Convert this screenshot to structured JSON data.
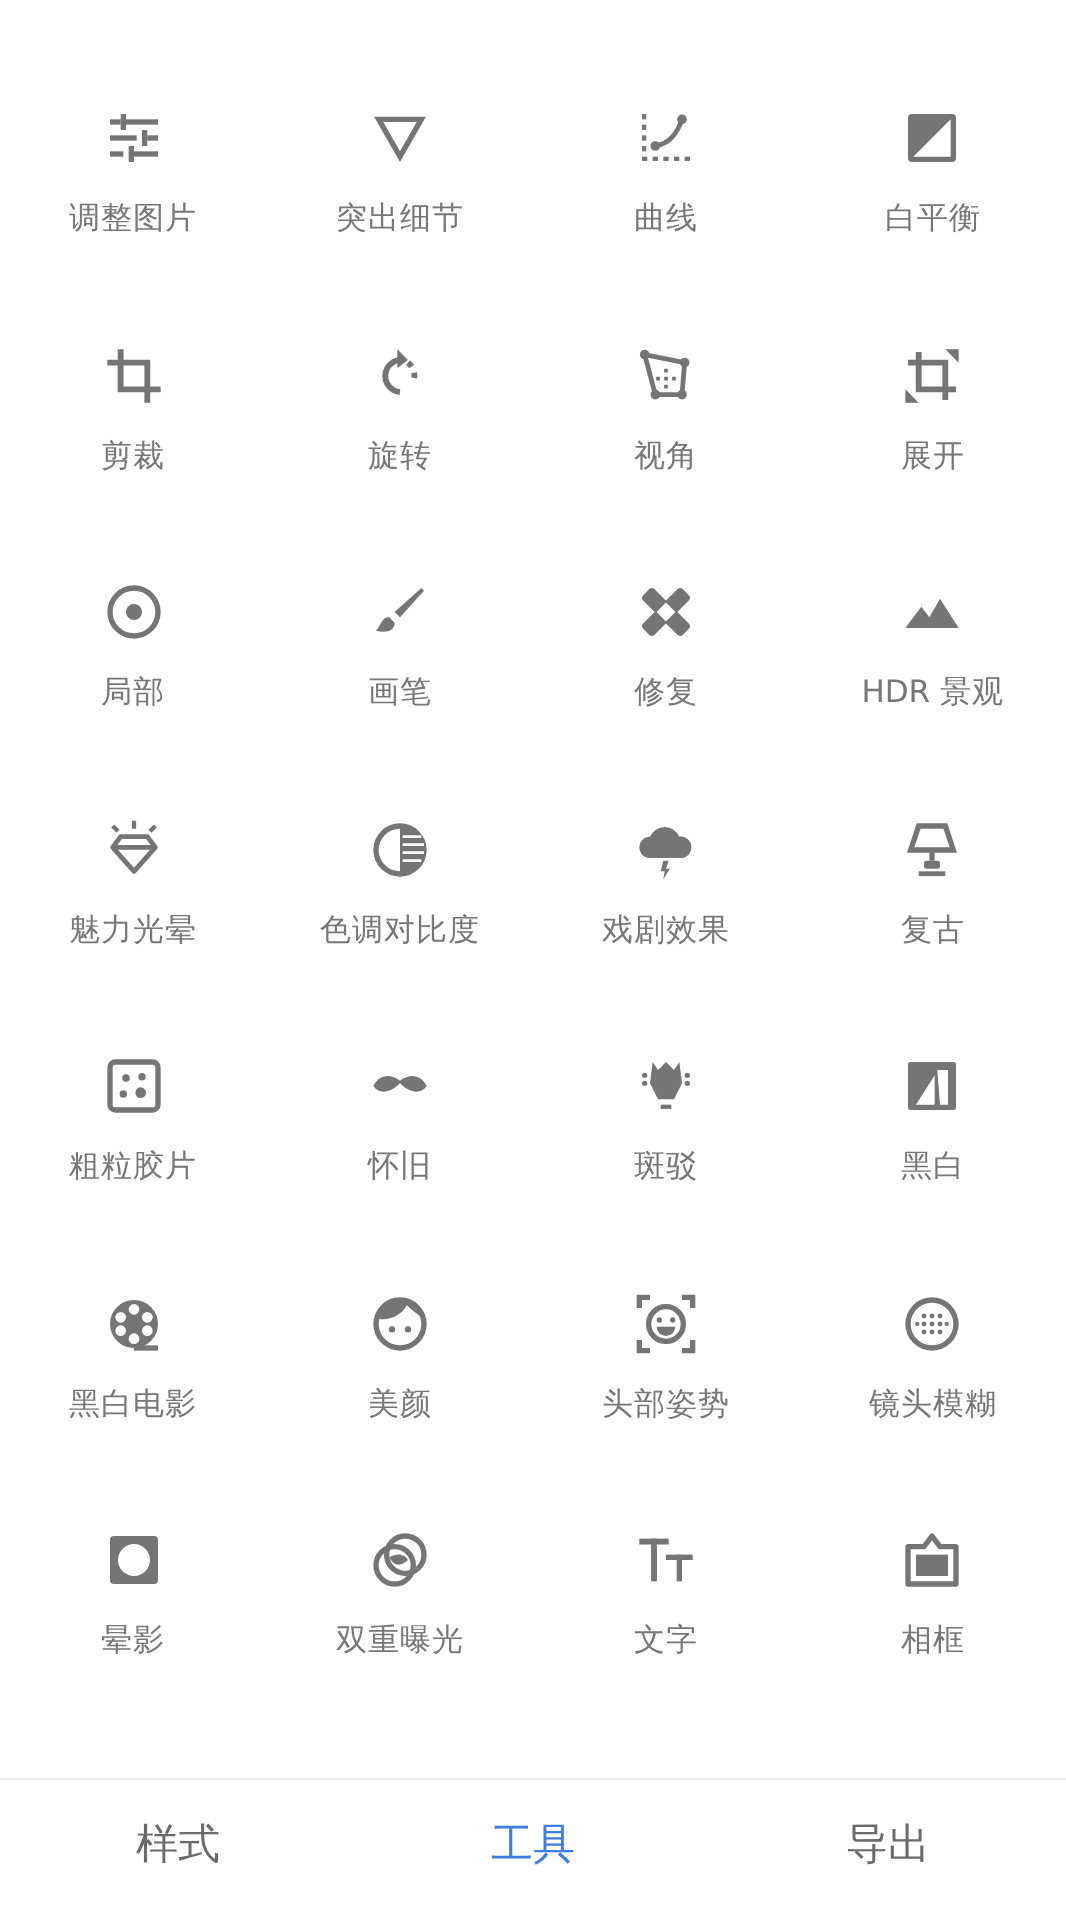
{
  "tools": [
    {
      "label": "调整图片"
    },
    {
      "label": "突出细节"
    },
    {
      "label": "曲线"
    },
    {
      "label": "白平衡"
    },
    {
      "label": "剪裁"
    },
    {
      "label": "旋转"
    },
    {
      "label": "视角"
    },
    {
      "label": "展开"
    },
    {
      "label": "局部"
    },
    {
      "label": "画笔"
    },
    {
      "label": "修复"
    },
    {
      "label": "HDR 景观"
    },
    {
      "label": "魅力光晕"
    },
    {
      "label": "色调对比度"
    },
    {
      "label": "戏剧效果"
    },
    {
      "label": "复古"
    },
    {
      "label": "粗粒胶片"
    },
    {
      "label": "怀旧"
    },
    {
      "label": "斑驳"
    },
    {
      "label": "黑白"
    },
    {
      "label": "黑白电影"
    },
    {
      "label": "美颜"
    },
    {
      "label": "头部姿势"
    },
    {
      "label": "镜头模糊"
    },
    {
      "label": "晕影"
    },
    {
      "label": "双重曝光"
    },
    {
      "label": "文字"
    },
    {
      "label": "相框"
    }
  ],
  "tabs": [
    {
      "label": "样式",
      "selected": false
    },
    {
      "label": "工具",
      "selected": true
    },
    {
      "label": "导出",
      "selected": false
    }
  ]
}
